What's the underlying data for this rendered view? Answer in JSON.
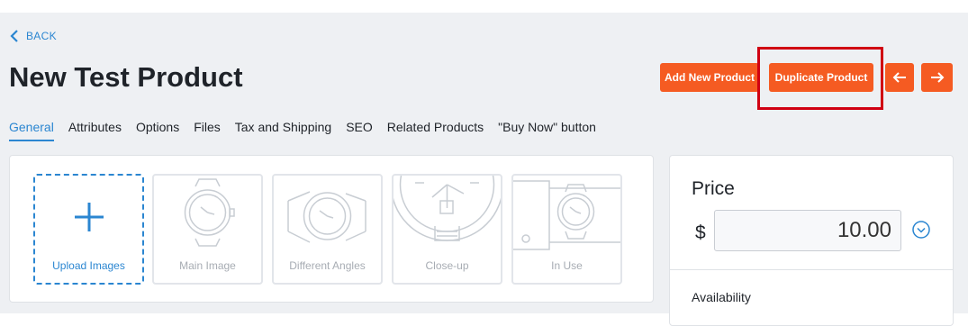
{
  "nav": {
    "back_label": "BACK"
  },
  "page": {
    "title": "New Test Product"
  },
  "actions": {
    "add_new_label": "Add New Product",
    "duplicate_label": "Duplicate Product",
    "prev_icon": "arrow-left-icon",
    "next_icon": "arrow-right-icon"
  },
  "tabs": [
    {
      "label": "General",
      "active": true
    },
    {
      "label": "Attributes"
    },
    {
      "label": "Options"
    },
    {
      "label": "Files"
    },
    {
      "label": "Tax and Shipping"
    },
    {
      "label": "SEO"
    },
    {
      "label": "Related Products"
    },
    {
      "label": "\"Buy Now\" button"
    }
  ],
  "images": {
    "upload_label": "Upload Images",
    "slots": [
      {
        "label": "Main Image",
        "icon": "watch-front-icon"
      },
      {
        "label": "Different Angles",
        "icon": "watch-angle-icon"
      },
      {
        "label": "Close-up",
        "icon": "watch-closeup-icon"
      },
      {
        "label": "In Use",
        "icon": "watch-wrist-icon"
      }
    ]
  },
  "pricing": {
    "title": "Price",
    "currency": "$",
    "value": "10.00",
    "availability_label": "Availability"
  },
  "colors": {
    "accent": "#f55b22",
    "link": "#2b86d1",
    "highlight": "#d00012"
  }
}
